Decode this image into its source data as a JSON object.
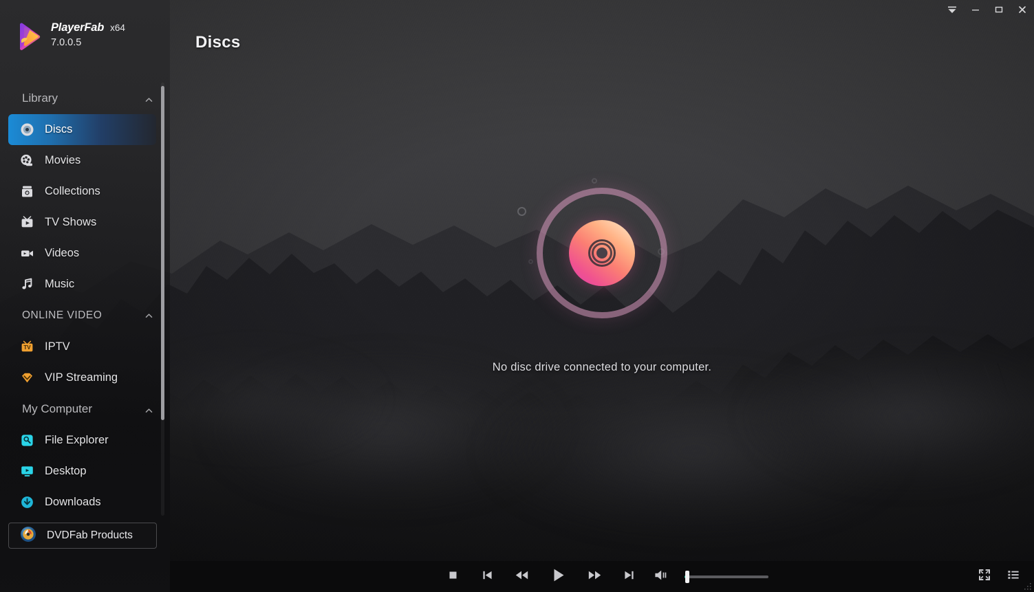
{
  "app": {
    "brand_name": "PlayerFab",
    "architecture": "x64",
    "version": "7.0.0.5",
    "logo_icon": "playerfab-logo-icon"
  },
  "titlebar": {
    "menu_label": "▼",
    "minimize_label": "─",
    "maximize_label": "□",
    "close_label": "✕",
    "icons": [
      "menu-icon",
      "minimize-icon",
      "maximize-icon",
      "close-icon"
    ]
  },
  "header": {
    "page_title": "Discs"
  },
  "sidebar": {
    "sections": [
      {
        "id": "library",
        "label": "Library",
        "caps": false,
        "collapse_icon": "chevron-up-icon",
        "items": [
          {
            "label": "Discs",
            "icon": "disc-icon",
            "active": true
          },
          {
            "label": "Movies",
            "icon": "film-reel-icon",
            "active": false
          },
          {
            "label": "Collections",
            "icon": "collection-icon",
            "active": false
          },
          {
            "label": "TV Shows",
            "icon": "tv-show-icon",
            "active": false
          },
          {
            "label": "Videos",
            "icon": "video-camera-icon",
            "active": false
          },
          {
            "label": "Music",
            "icon": "music-note-icon",
            "active": false
          }
        ]
      },
      {
        "id": "online-video",
        "label": "ONLINE VIDEO",
        "caps": true,
        "collapse_icon": "chevron-up-icon",
        "items": [
          {
            "label": "IPTV",
            "icon": "iptv-icon",
            "active": false
          },
          {
            "label": "VIP Streaming",
            "icon": "vip-diamond-icon",
            "active": false
          }
        ]
      },
      {
        "id": "my-computer",
        "label": "My Computer",
        "caps": false,
        "collapse_icon": "chevron-up-icon",
        "items": [
          {
            "label": "File Explorer",
            "icon": "file-explorer-icon",
            "active": false
          },
          {
            "label": "Desktop",
            "icon": "desktop-icon",
            "active": false
          },
          {
            "label": "Downloads",
            "icon": "downloads-icon",
            "active": false
          }
        ]
      }
    ],
    "products_button": {
      "label": "DVDFab Products",
      "icon": "dvdfab-logo-icon"
    }
  },
  "main": {
    "empty_state": {
      "graphic": "disc-graphic",
      "message": "No disc drive connected to your computer."
    }
  },
  "controls": {
    "buttons": [
      {
        "name": "stop-button",
        "icon": "stop-icon"
      },
      {
        "name": "previous-button",
        "icon": "skip-previous-icon"
      },
      {
        "name": "rewind-button",
        "icon": "rewind-icon"
      },
      {
        "name": "play-button",
        "icon": "play-icon"
      },
      {
        "name": "fast-forward-button",
        "icon": "fast-forward-icon"
      },
      {
        "name": "next-button",
        "icon": "skip-next-icon"
      }
    ],
    "volume": {
      "icon": "volume-icon",
      "level": 2
    },
    "right_buttons": [
      {
        "name": "fullscreen-button",
        "icon": "fullscreen-icon"
      },
      {
        "name": "playlist-button",
        "icon": "playlist-icon"
      }
    ],
    "resize_grip_icon": "resize-grip-icon"
  },
  "colors": {
    "accent_blue": "#1b8bd6",
    "accent_teal": "#22d3a8",
    "disc_pink": "#e03fb0",
    "disc_peach": "#ffe6cf",
    "iptv_orange": "#f0a030",
    "explorer_cyan": "#2ad4e8",
    "control_bar_bg": "#0b0b0c",
    "sidebar_bg": "#2b2b2d"
  }
}
